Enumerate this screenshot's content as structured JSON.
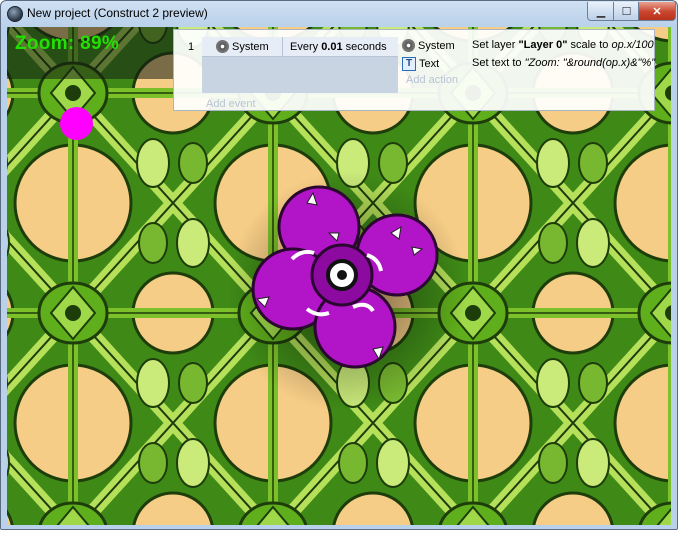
{
  "window": {
    "title": "New project (Construct 2 preview)",
    "min_glyph": "▁",
    "max_glyph": "☐",
    "close_glyph": "✕"
  },
  "game": {
    "zoom_text": "Zoom: 89%",
    "dot_color": "#ff00ff"
  },
  "event_sheet": {
    "event_number": "1",
    "condition": {
      "object": "System",
      "text_prefix": "Every ",
      "text_value": "0.01",
      "text_suffix": " seconds"
    },
    "actions": [
      {
        "object": "System",
        "icon": "gear-icon",
        "text_prefix": "Set layer ",
        "text_bold": "\"Layer 0\"",
        "text_mid": " scale to ",
        "text_italic": "op.x/100"
      },
      {
        "object": "Text",
        "icon": "text-object-icon",
        "icon_glyph": "T",
        "text_prefix": "Set text to ",
        "text_bold": "",
        "text_mid": "",
        "text_italic": "\"Zoom: \"&round(op.x)&\"%\""
      }
    ],
    "add_action": "Add action",
    "add_event": "Add event"
  }
}
